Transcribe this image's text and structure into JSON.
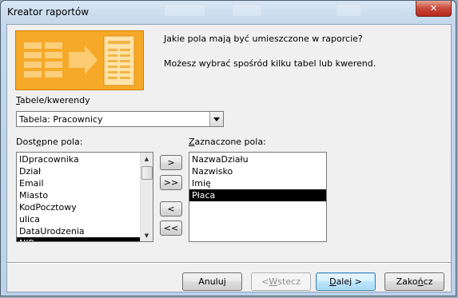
{
  "window": {
    "title": "Kreator raportów",
    "close_glyph": "✕"
  },
  "header": {
    "question": "Jakie pola mają być umieszczone w raporcie?",
    "hint": "Możesz wybrać spośród kilku tabel lub kwerend."
  },
  "source": {
    "label_accel": "T",
    "label_rest": "abele/kwerendy",
    "selected": "Tabela: Pracownicy"
  },
  "available": {
    "label_pre": "Dost",
    "label_accel": "ę",
    "label_post": "pne pola:",
    "items": [
      "IDpracownika",
      "Dział",
      "Email",
      "Miasto",
      "KodPocztowy",
      "ulica",
      "DataUrodzenia",
      "NIP"
    ],
    "selected_index": 7
  },
  "selected_fields": {
    "label_accel": "Z",
    "label_rest": "aznaczone pola:",
    "items": [
      "NazwaDziału",
      "Nazwisko",
      "Imię",
      "Płaca"
    ],
    "selected_index": 3
  },
  "move_buttons": {
    "add_one": ">",
    "add_all": ">>",
    "remove_one": "<",
    "remove_all": "<<"
  },
  "footer": {
    "cancel": "Anuluj",
    "back_pre": "< ",
    "back_accel": "W",
    "back_post": "stecz",
    "next_accel": "D",
    "next_post": "alej >",
    "finish_pre": "Zako",
    "finish_accel": "ń",
    "finish_post": "cz"
  },
  "colors": {
    "selection": "#000000",
    "banner": "#f6a928",
    "title_bar": "#c4d7ec"
  }
}
